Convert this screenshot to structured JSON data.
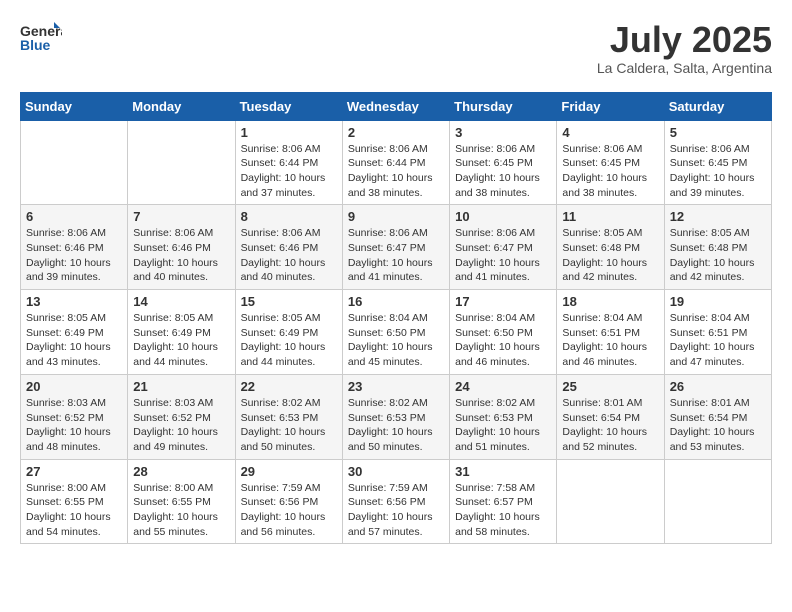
{
  "logo": {
    "line1": "General",
    "line2": "Blue"
  },
  "title": "July 2025",
  "location": "La Caldera, Salta, Argentina",
  "weekdays": [
    "Sunday",
    "Monday",
    "Tuesday",
    "Wednesday",
    "Thursday",
    "Friday",
    "Saturday"
  ],
  "weeks": [
    [
      {
        "day": "",
        "sunrise": "",
        "sunset": "",
        "daylight": ""
      },
      {
        "day": "",
        "sunrise": "",
        "sunset": "",
        "daylight": ""
      },
      {
        "day": "1",
        "sunrise": "Sunrise: 8:06 AM",
        "sunset": "Sunset: 6:44 PM",
        "daylight": "Daylight: 10 hours and 37 minutes."
      },
      {
        "day": "2",
        "sunrise": "Sunrise: 8:06 AM",
        "sunset": "Sunset: 6:44 PM",
        "daylight": "Daylight: 10 hours and 38 minutes."
      },
      {
        "day": "3",
        "sunrise": "Sunrise: 8:06 AM",
        "sunset": "Sunset: 6:45 PM",
        "daylight": "Daylight: 10 hours and 38 minutes."
      },
      {
        "day": "4",
        "sunrise": "Sunrise: 8:06 AM",
        "sunset": "Sunset: 6:45 PM",
        "daylight": "Daylight: 10 hours and 38 minutes."
      },
      {
        "day": "5",
        "sunrise": "Sunrise: 8:06 AM",
        "sunset": "Sunset: 6:45 PM",
        "daylight": "Daylight: 10 hours and 39 minutes."
      }
    ],
    [
      {
        "day": "6",
        "sunrise": "Sunrise: 8:06 AM",
        "sunset": "Sunset: 6:46 PM",
        "daylight": "Daylight: 10 hours and 39 minutes."
      },
      {
        "day": "7",
        "sunrise": "Sunrise: 8:06 AM",
        "sunset": "Sunset: 6:46 PM",
        "daylight": "Daylight: 10 hours and 40 minutes."
      },
      {
        "day": "8",
        "sunrise": "Sunrise: 8:06 AM",
        "sunset": "Sunset: 6:46 PM",
        "daylight": "Daylight: 10 hours and 40 minutes."
      },
      {
        "day": "9",
        "sunrise": "Sunrise: 8:06 AM",
        "sunset": "Sunset: 6:47 PM",
        "daylight": "Daylight: 10 hours and 41 minutes."
      },
      {
        "day": "10",
        "sunrise": "Sunrise: 8:06 AM",
        "sunset": "Sunset: 6:47 PM",
        "daylight": "Daylight: 10 hours and 41 minutes."
      },
      {
        "day": "11",
        "sunrise": "Sunrise: 8:05 AM",
        "sunset": "Sunset: 6:48 PM",
        "daylight": "Daylight: 10 hours and 42 minutes."
      },
      {
        "day": "12",
        "sunrise": "Sunrise: 8:05 AM",
        "sunset": "Sunset: 6:48 PM",
        "daylight": "Daylight: 10 hours and 42 minutes."
      }
    ],
    [
      {
        "day": "13",
        "sunrise": "Sunrise: 8:05 AM",
        "sunset": "Sunset: 6:49 PM",
        "daylight": "Daylight: 10 hours and 43 minutes."
      },
      {
        "day": "14",
        "sunrise": "Sunrise: 8:05 AM",
        "sunset": "Sunset: 6:49 PM",
        "daylight": "Daylight: 10 hours and 44 minutes."
      },
      {
        "day": "15",
        "sunrise": "Sunrise: 8:05 AM",
        "sunset": "Sunset: 6:49 PM",
        "daylight": "Daylight: 10 hours and 44 minutes."
      },
      {
        "day": "16",
        "sunrise": "Sunrise: 8:04 AM",
        "sunset": "Sunset: 6:50 PM",
        "daylight": "Daylight: 10 hours and 45 minutes."
      },
      {
        "day": "17",
        "sunrise": "Sunrise: 8:04 AM",
        "sunset": "Sunset: 6:50 PM",
        "daylight": "Daylight: 10 hours and 46 minutes."
      },
      {
        "day": "18",
        "sunrise": "Sunrise: 8:04 AM",
        "sunset": "Sunset: 6:51 PM",
        "daylight": "Daylight: 10 hours and 46 minutes."
      },
      {
        "day": "19",
        "sunrise": "Sunrise: 8:04 AM",
        "sunset": "Sunset: 6:51 PM",
        "daylight": "Daylight: 10 hours and 47 minutes."
      }
    ],
    [
      {
        "day": "20",
        "sunrise": "Sunrise: 8:03 AM",
        "sunset": "Sunset: 6:52 PM",
        "daylight": "Daylight: 10 hours and 48 minutes."
      },
      {
        "day": "21",
        "sunrise": "Sunrise: 8:03 AM",
        "sunset": "Sunset: 6:52 PM",
        "daylight": "Daylight: 10 hours and 49 minutes."
      },
      {
        "day": "22",
        "sunrise": "Sunrise: 8:02 AM",
        "sunset": "Sunset: 6:53 PM",
        "daylight": "Daylight: 10 hours and 50 minutes."
      },
      {
        "day": "23",
        "sunrise": "Sunrise: 8:02 AM",
        "sunset": "Sunset: 6:53 PM",
        "daylight": "Daylight: 10 hours and 50 minutes."
      },
      {
        "day": "24",
        "sunrise": "Sunrise: 8:02 AM",
        "sunset": "Sunset: 6:53 PM",
        "daylight": "Daylight: 10 hours and 51 minutes."
      },
      {
        "day": "25",
        "sunrise": "Sunrise: 8:01 AM",
        "sunset": "Sunset: 6:54 PM",
        "daylight": "Daylight: 10 hours and 52 minutes."
      },
      {
        "day": "26",
        "sunrise": "Sunrise: 8:01 AM",
        "sunset": "Sunset: 6:54 PM",
        "daylight": "Daylight: 10 hours and 53 minutes."
      }
    ],
    [
      {
        "day": "27",
        "sunrise": "Sunrise: 8:00 AM",
        "sunset": "Sunset: 6:55 PM",
        "daylight": "Daylight: 10 hours and 54 minutes."
      },
      {
        "day": "28",
        "sunrise": "Sunrise: 8:00 AM",
        "sunset": "Sunset: 6:55 PM",
        "daylight": "Daylight: 10 hours and 55 minutes."
      },
      {
        "day": "29",
        "sunrise": "Sunrise: 7:59 AM",
        "sunset": "Sunset: 6:56 PM",
        "daylight": "Daylight: 10 hours and 56 minutes."
      },
      {
        "day": "30",
        "sunrise": "Sunrise: 7:59 AM",
        "sunset": "Sunset: 6:56 PM",
        "daylight": "Daylight: 10 hours and 57 minutes."
      },
      {
        "day": "31",
        "sunrise": "Sunrise: 7:58 AM",
        "sunset": "Sunset: 6:57 PM",
        "daylight": "Daylight: 10 hours and 58 minutes."
      },
      {
        "day": "",
        "sunrise": "",
        "sunset": "",
        "daylight": ""
      },
      {
        "day": "",
        "sunrise": "",
        "sunset": "",
        "daylight": ""
      }
    ]
  ]
}
